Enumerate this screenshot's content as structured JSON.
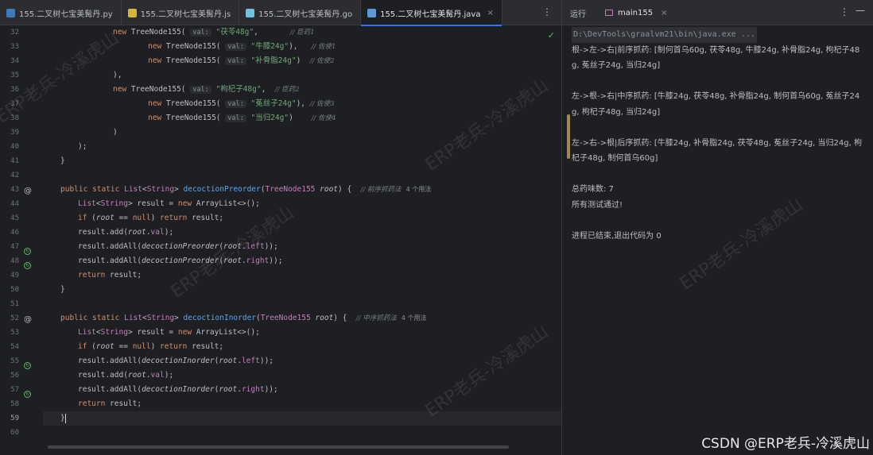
{
  "editor": {
    "tabs": [
      {
        "label": "155.二叉树七宝美髯丹.py",
        "icon": "python-file-icon",
        "color": "#3d7ab8",
        "active": false
      },
      {
        "label": "155.二叉树七宝美髯丹.js",
        "icon": "javascript-file-icon",
        "color": "#d7b33a",
        "active": false
      },
      {
        "label": "155.二叉树七宝美髯丹.go",
        "icon": "go-file-icon",
        "color": "#6fc3df",
        "active": false
      },
      {
        "label": "155.二叉树七宝美髯丹.java",
        "icon": "java-file-icon",
        "color": "#5b9bd5",
        "active": true
      }
    ],
    "more_icon": "⋮",
    "close_icon": "×",
    "check_icon": "✓",
    "line_numbers": [
      "32",
      "33",
      "34",
      "35",
      "36",
      "37",
      "38",
      "39",
      "40",
      "41",
      "42",
      "43",
      "44",
      "45",
      "46",
      "47",
      "48",
      "49",
      "50",
      "51",
      "52",
      "53",
      "54",
      "55",
      "56",
      "57",
      "58",
      "59",
      "60"
    ],
    "current_line": "59",
    "usage_42": "4 个用法",
    "usage_52": "4 个用法",
    "comment_root_pre": "// 前序抓药法",
    "comment_root_in": "// 中序抓药法",
    "node1": {
      "val_hint": "val:",
      "value": "\"茯苓48g\"",
      "comment": "// 臣药1"
    },
    "node2": {
      "val_hint": "val:",
      "value": "\"牛膝24g\"",
      "comment": "// 佐使1"
    },
    "node3": {
      "val_hint": "val:",
      "value": "\"补骨脂24g\"",
      "comment": "// 佐使2"
    },
    "node4": {
      "val_hint": "val:",
      "value": "\"枸杞子48g\"",
      "comment": "// 臣药2"
    },
    "node5": {
      "val_hint": "val:",
      "value": "\"菟丝子24g\"",
      "comment": "// 佐使3"
    },
    "node6": {
      "val_hint": "val:",
      "value": "\"当归24g\"",
      "comment": "// 佐使4"
    }
  },
  "run": {
    "label": "运行",
    "tab_label": "main155",
    "close_icon": "×",
    "more_icon": "⋮",
    "minimize_icon": "—",
    "command": "D:\\DevTools\\graalvm21\\bin\\java.exe ...",
    "output": [
      "根->左->右|前序抓药: [制何首乌60g, 茯苓48g, 牛膝24g, 补骨脂24g, 枸杞子48g, 菟丝子24g, 当归24g]",
      "",
      "左->根->右|中序抓药: [牛膝24g, 茯苓48g, 补骨脂24g, 制何首乌60g, 菟丝子24g, 枸杞子48g, 当归24g]",
      "",
      "左->右->根|后序抓药: [牛膝24g, 补骨脂24g, 茯苓48g, 菟丝子24g, 当归24g, 枸杞子48g, 制何首乌60g]",
      "",
      "总药味数: 7",
      "所有测试通过!",
      "",
      "进程已结束,退出代码为 0"
    ]
  },
  "watermark": "ERP老兵-冷溪虎山",
  "footer_credit": "CSDN @ERP老兵-冷溪虎山"
}
